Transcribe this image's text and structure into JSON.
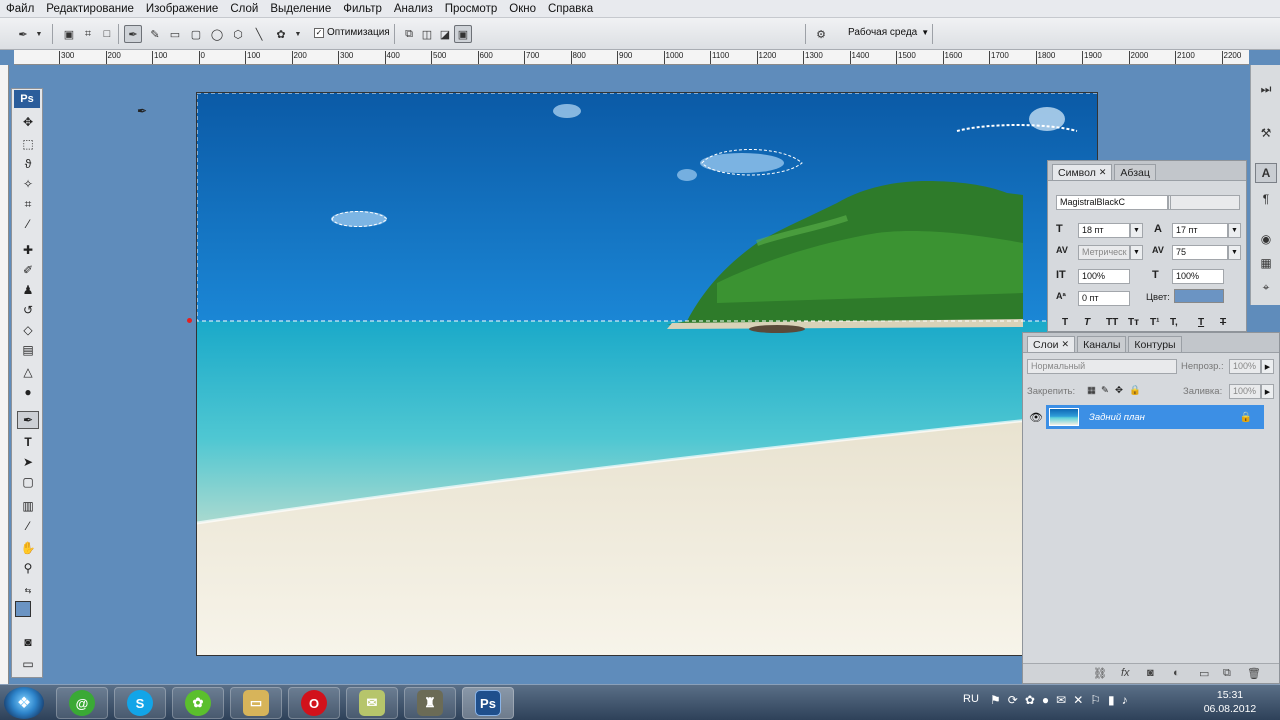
{
  "menu": [
    "Файл",
    "Редактирование",
    "Изображение",
    "Слой",
    "Выделение",
    "Фильтр",
    "Анализ",
    "Просмотр",
    "Окно",
    "Справка"
  ],
  "options_bar": {
    "optimize_label": "Оптимизация",
    "workspace_label": "Рабочая среда"
  },
  "ruler": {
    "ticks": [
      "300",
      "200",
      "100",
      "0",
      "100",
      "200",
      "300",
      "400",
      "500",
      "600",
      "700",
      "800",
      "900",
      "1000",
      "1100",
      "1200",
      "1300",
      "1400",
      "1500",
      "1600",
      "1700",
      "1800",
      "1900",
      "2000",
      "2100",
      "2200"
    ]
  },
  "toolbox": {
    "logo": "Ps"
  },
  "character_panel": {
    "tab_symbol": "Символ",
    "tab_paragraph": "Абзац",
    "font_family": "MagistralBlackC",
    "font_size": "18 пт",
    "leading": "17 пт",
    "kerning": "Метрическ",
    "tracking": "75",
    "vertical_scale": "100%",
    "horizontal_scale": "100%",
    "baseline_shift": "0 пт",
    "color_label": "Цвет:",
    "color_value": "#6b94c3",
    "style_buttons": [
      "T",
      "T",
      "TT",
      "Tт",
      "T¹",
      "T,",
      "T",
      "T"
    ]
  },
  "layers_panel": {
    "tabs": [
      "Слои",
      "Каналы",
      "Контуры"
    ],
    "blend_mode": "Нормальный",
    "opacity_label": "Непрозр.:",
    "opacity_value": "100%",
    "lock_label": "Закрепить:",
    "fill_label": "Заливка:",
    "fill_value": "100%",
    "layers": [
      {
        "name": "Задний план",
        "visible": true,
        "locked": true
      }
    ]
  },
  "taskbar": {
    "apps": [
      "icq-icon",
      "skype-icon",
      "icq-flower-icon",
      "folder-icon",
      "opera-icon",
      "notes-icon",
      "media-icon",
      "photoshop-icon"
    ],
    "lang": "RU",
    "time": "15:31",
    "date": "06.08.2012"
  }
}
